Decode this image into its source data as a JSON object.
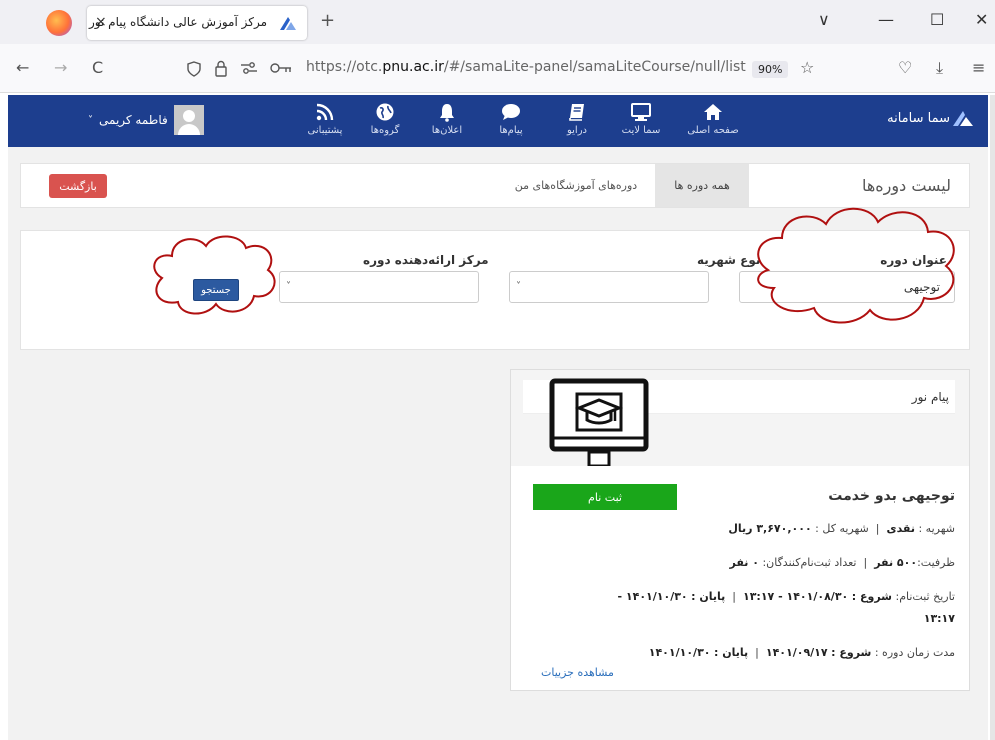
{
  "browser": {
    "tab_title": "مرکز آموزش عالی دانشگاه پیام نور",
    "tab_close": "×",
    "new_tab": "+",
    "url_prefix": "https://otc.",
    "url_domain": "pnu.ac.ir",
    "url_path": "/#/samaLite-panel/samaLiteCourse/null/list",
    "zoom": "90%",
    "back": "←",
    "forward": "→",
    "reload": "C",
    "tabs_dropdown": "∨",
    "minimize": "—",
    "maximize": "☐",
    "close": "✕",
    "star": "☆",
    "pocket": "♡",
    "download": "⤓",
    "menu": "≡"
  },
  "header": {
    "logo_text": "سما سامانه",
    "nav": [
      {
        "label": "صفحه اصلی",
        "icon": "home-icon"
      },
      {
        "label": "سما لایت",
        "icon": "monitor-icon"
      },
      {
        "label": "درایو",
        "icon": "book-icon"
      },
      {
        "label": "پیام‌ها",
        "icon": "chat-icon"
      },
      {
        "label": "اعلان‌ها",
        "icon": "bell-icon"
      },
      {
        "label": "گروه‌ها",
        "icon": "globe-icon"
      },
      {
        "label": "پشتیبانی",
        "icon": "rss-icon"
      }
    ],
    "user_name": "فاطمه کریمی",
    "user_chevron": "˅",
    "colors": {
      "bar": "#1d3e8e"
    }
  },
  "list": {
    "title": "لیست دوره‌ها",
    "tab_all": "همه دوره ها",
    "tab_mine": "دوره‌های آموزشگاه‌های من",
    "back_button": "بازگشت"
  },
  "filters": {
    "course_title_label": "عنوان دوره",
    "course_title_value": "توجیهی",
    "fee_type_label": "نوع شهریه",
    "provider_label": "مرکز ارائه‌دهنده دوره",
    "chevron": "˅",
    "search_button": "جستجو"
  },
  "course": {
    "provider": "پیام نور",
    "register_button": "ثبت نام",
    "title": "توجیهی بدو خدمت",
    "fee_line": {
      "type_label": "شهریه :",
      "type_value": "نقدی",
      "sep": "|",
      "total_label": "شهریه کل :",
      "total_value": "۳,۶۷۰,۰۰۰ ریال"
    },
    "capacity_line": {
      "capacity_label": "ظرفیت:",
      "capacity_value": "۵۰۰ نفر",
      "sep": "|",
      "registered_label": "تعداد ثبت‌نام‌کنندگان:",
      "registered_value": "۰ نفر"
    },
    "registration_line": {
      "label": "تاریخ ثبت‌نام:",
      "start_label": "شروع :",
      "start_value": "۱۴۰۱/۰۸/۳۰ - ۱۳:۱۷",
      "sep": "|",
      "end_label": "پایان :",
      "end_value": "۱۴۰۱/۱۰/۳۰ -",
      "end_time": "۱۳:۱۷"
    },
    "duration_line": {
      "label": "مدت زمان دوره :",
      "start_label": "شروع :",
      "start_value": "۱۴۰۱/۰۹/۱۷",
      "sep": "|",
      "end_label": "پایان :",
      "end_value": "۱۴۰۱/۱۰/۳۰"
    },
    "details_link": "مشاهده جزییات",
    "colors": {
      "register": "#1aa61a",
      "back": "#d9534f",
      "search": "#2c5aa0"
    }
  }
}
